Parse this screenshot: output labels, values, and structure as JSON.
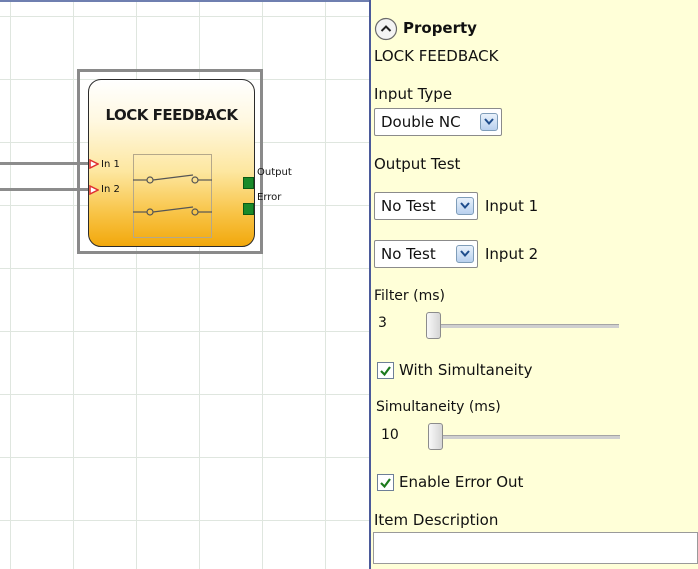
{
  "block": {
    "title": "LOCK FEEDBACK",
    "inputs": [
      "In 1",
      "In 2"
    ],
    "outputs": [
      "Output",
      "Error"
    ]
  },
  "panel": {
    "header": "Property",
    "element_name": "LOCK FEEDBACK",
    "input_type": {
      "label": "Input Type",
      "value": "Double NC"
    },
    "output_test": {
      "label": "Output Test",
      "input1": {
        "value": "No Test",
        "label": "Input 1"
      },
      "input2": {
        "value": "No Test",
        "label": "Input 2"
      }
    },
    "filter": {
      "label": "Filter (ms)",
      "value": "3"
    },
    "with_simultaneity": {
      "label": "With Simultaneity",
      "checked": true
    },
    "simultaneity": {
      "label": "Simultaneity (ms)",
      "value": "10"
    },
    "enable_error_out": {
      "label": "Enable Error Out",
      "checked": true
    },
    "item_description": {
      "label": "Item Description",
      "value": ""
    }
  },
  "colors": {
    "panel_bg": "#ffffd8",
    "block_gradient_bottom": "#f2a80c",
    "output_pin": "#1a8a2a",
    "input_pin": "#e03030"
  },
  "icons": {
    "collapse": "chevron-up-circle-icon",
    "dropdown": "chevron-down-icon",
    "checkbox": "checkmark-icon"
  }
}
